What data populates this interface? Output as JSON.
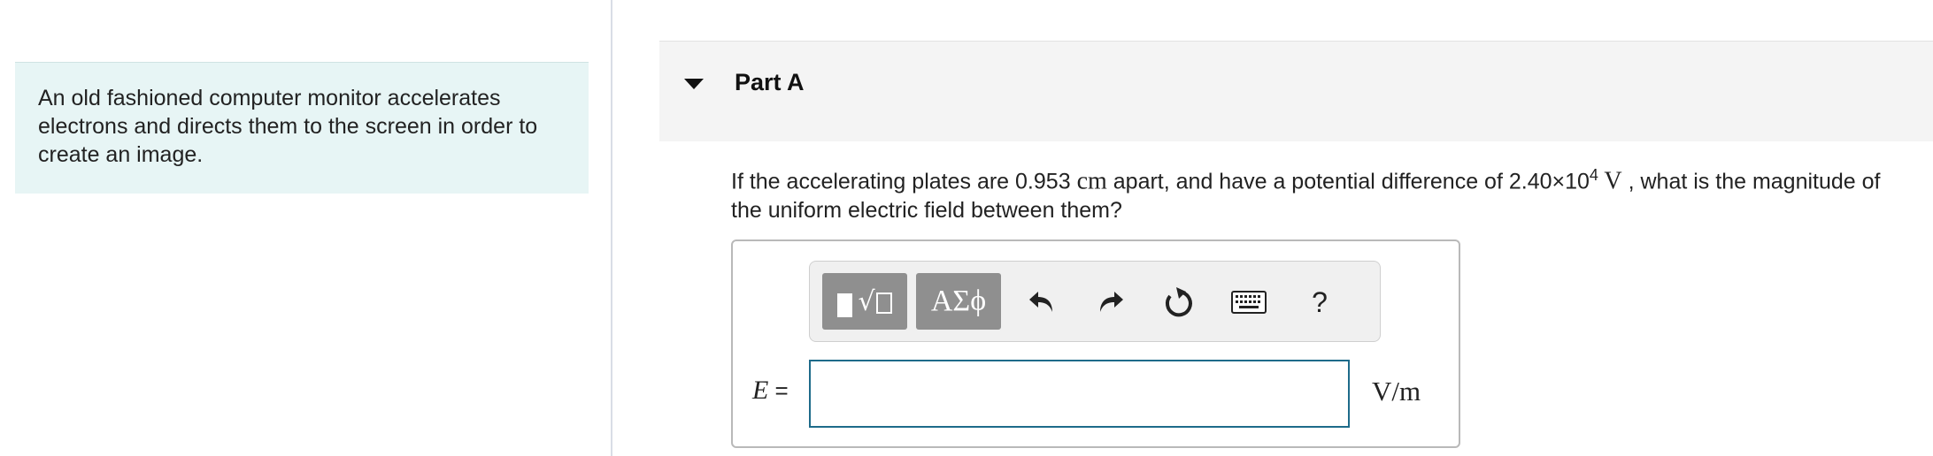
{
  "intro": {
    "text": "An old fashioned computer monitor accelerates electrons and directs them to the screen in order to create an image."
  },
  "part": {
    "title": "Part A"
  },
  "question": {
    "before_distance": "If the accelerating plates are ",
    "distance_value": "0.953",
    "distance_unit": " cm",
    "middle": " apart, and have a potential difference of ",
    "voltage_mantissa": "2.40×10",
    "voltage_exponent": "4",
    "voltage_unit": " V",
    "after": " , what is the magnitude of",
    "line2": "the uniform electric field between them?"
  },
  "toolbar": {
    "greek_label": "ΑΣϕ",
    "help_label": "?"
  },
  "answer": {
    "variable": "E",
    "equals": " =",
    "value": "",
    "unit": "V/m"
  },
  "colors": {
    "intro_bg": "#e7f5f5",
    "header_bg": "#f4f4f4",
    "tool_btn": "#8f8f8f",
    "input_border": "#1e6b8a"
  }
}
